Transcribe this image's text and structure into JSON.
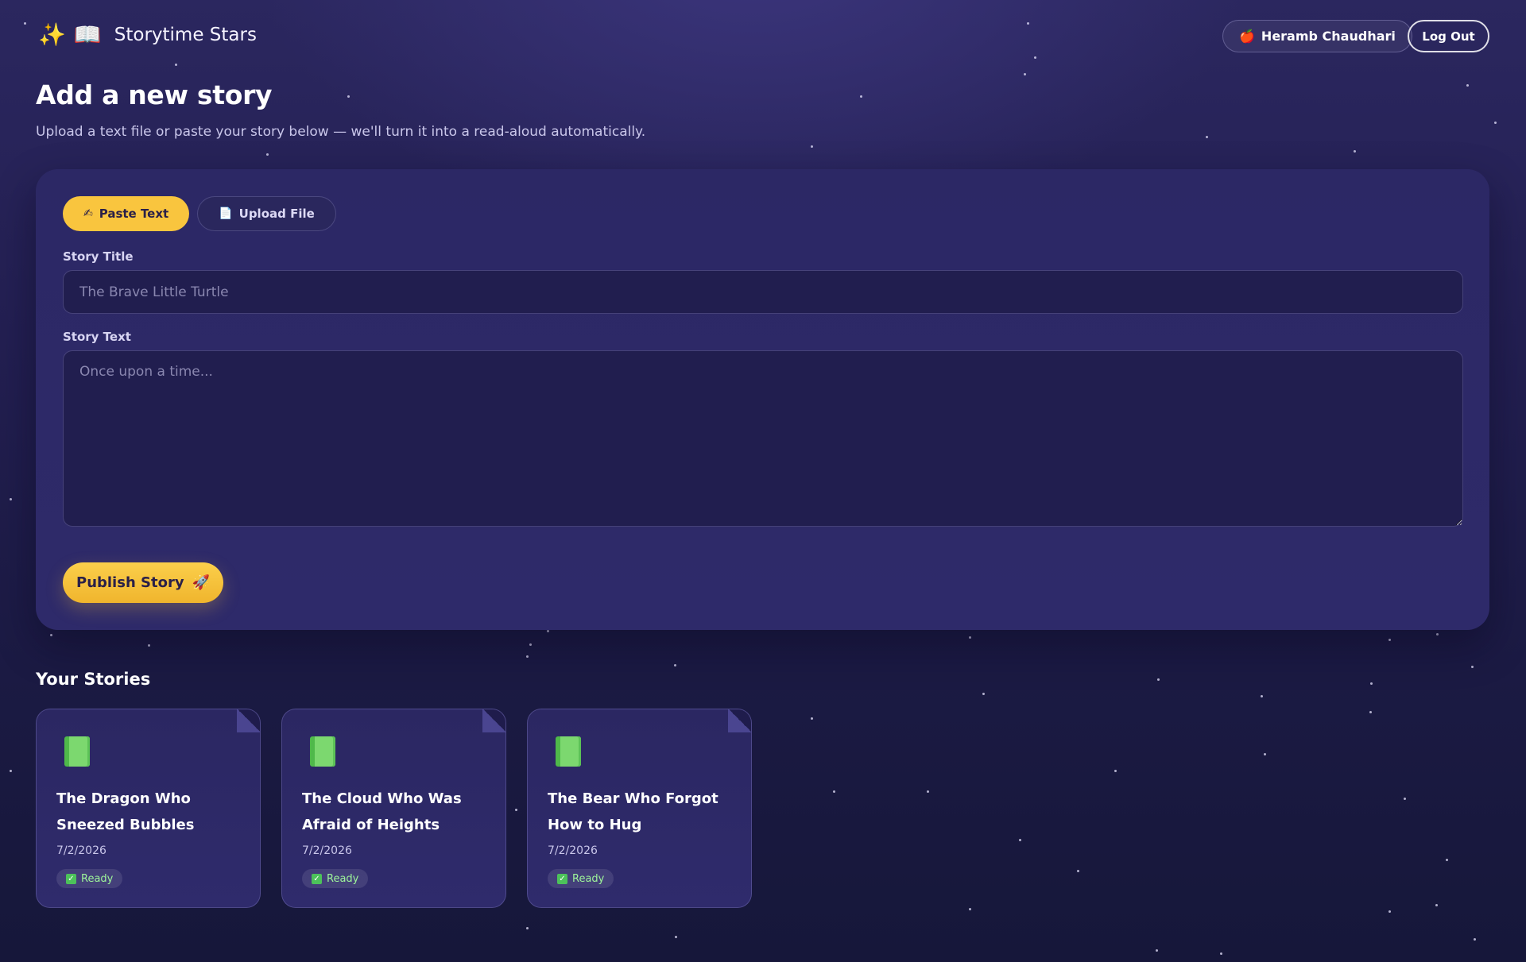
{
  "colors": {
    "accent": "#f9c53e",
    "background": "#1d1b48",
    "card": "#2e2a6a",
    "ready": "#9ef59a"
  },
  "header": {
    "brand_icon_1": "✨",
    "brand_icon_2": "📖",
    "brand_name": "Storytime Stars",
    "user_icon": "🍎",
    "user_name": "Heramb Chaudhari",
    "logout_label": "Log Out"
  },
  "page": {
    "title": "Add a new story",
    "subtitle": "Upload a text file or paste your story below — we'll turn it into a read-aloud automatically."
  },
  "form": {
    "tabs": [
      {
        "label": "Paste Text",
        "icon": "✍",
        "icon_name": "writing-hand-icon",
        "active": true
      },
      {
        "label": "Upload File",
        "icon": "📄",
        "icon_name": "document-icon",
        "active": false
      }
    ],
    "title_label": "Story Title",
    "title_placeholder": "The Brave Little Turtle",
    "title_value": "",
    "text_label": "Story Text",
    "text_placeholder": "Once upon a time...",
    "text_value": "",
    "publish_label": "Publish Story",
    "publish_icon": "🚀"
  },
  "stories": {
    "section_title": "Your Stories",
    "items": [
      {
        "title": "The Dragon Who Sneezed Bubbles",
        "date": "7/2/2026",
        "status": "Ready",
        "icon": "green-book-icon"
      },
      {
        "title": "The Cloud Who Was Afraid of Heights",
        "date": "7/2/2026",
        "status": "Ready",
        "icon": "green-book-icon"
      },
      {
        "title": "The Bear Who Forgot How to Hug",
        "date": "7/2/2026",
        "status": "Ready",
        "icon": "green-book-icon"
      }
    ]
  }
}
